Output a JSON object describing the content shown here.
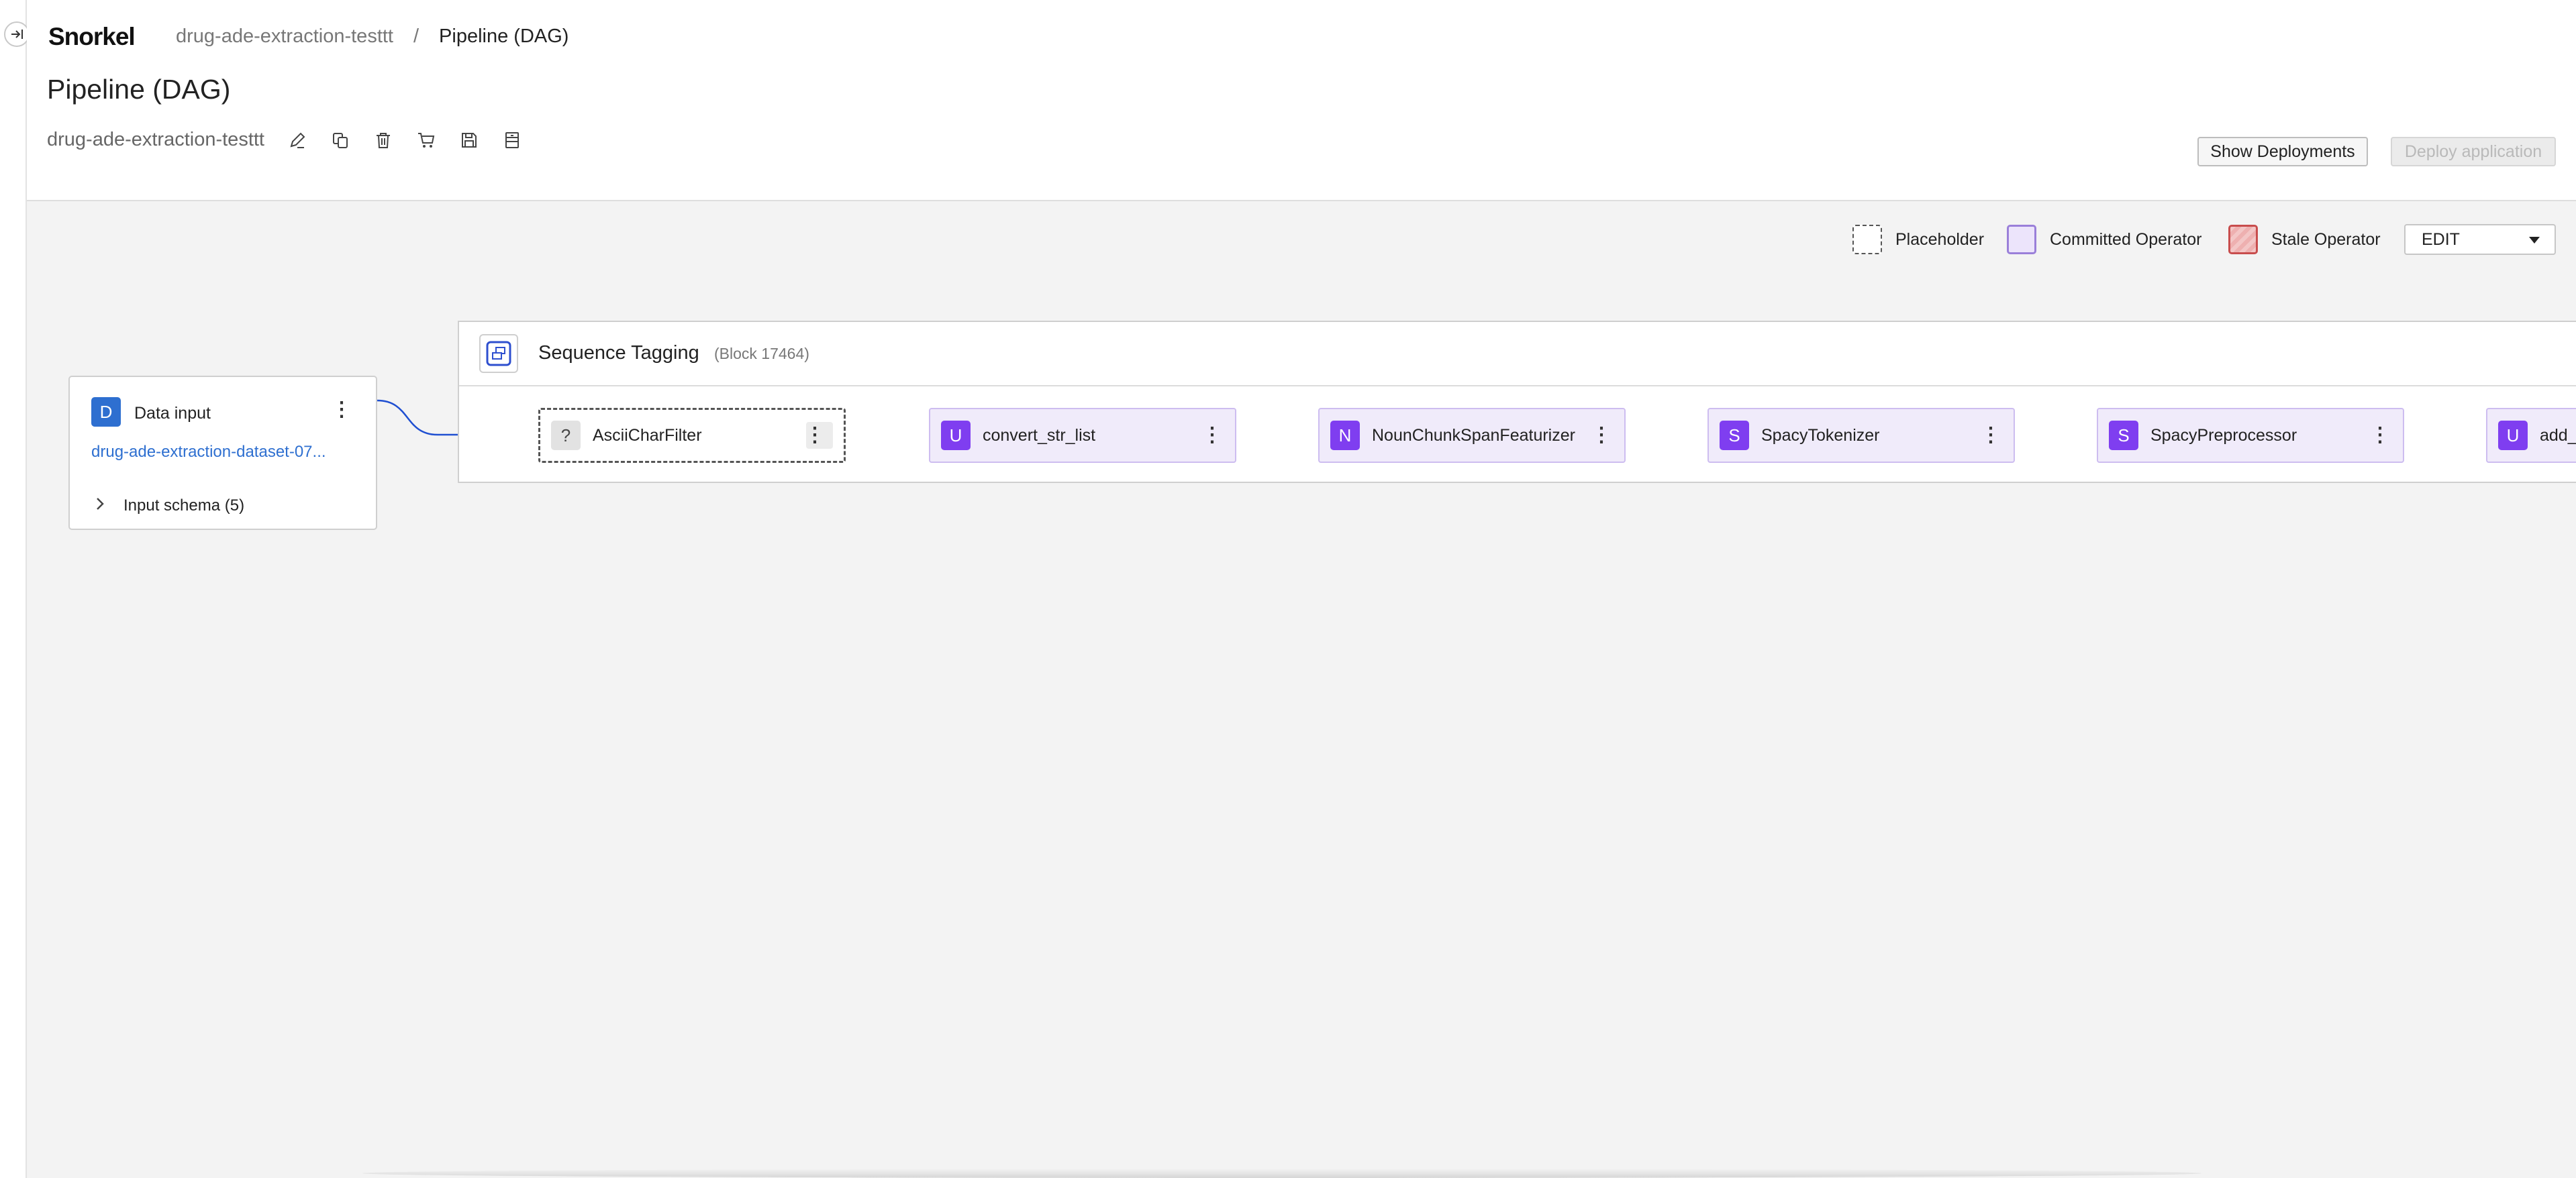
{
  "brand": {
    "logo_text": "Snorkel"
  },
  "breadcrumb": {
    "project": "drug-ade-extraction-testtt",
    "separator": "/",
    "current": "Pipeline (DAG)"
  },
  "page": {
    "title": "Pipeline (DAG)"
  },
  "app": {
    "name": "drug-ade-extraction-testtt",
    "tools": [
      "edit-icon",
      "copy-icon",
      "delete-icon",
      "cart-icon",
      "save-icon",
      "archive-icon"
    ]
  },
  "actions": {
    "show_deployments": "Show Deployments",
    "deploy_application": "Deploy application"
  },
  "legend": {
    "placeholder": "Placeholder",
    "committed": "Committed Operator",
    "stale": "Stale Operator"
  },
  "mode": {
    "selected": "EDIT"
  },
  "data_input": {
    "badge": "D",
    "title": "Data input",
    "dataset": "drug-ade-extraction-dataset-07...",
    "schema_label": "Input schema (5)"
  },
  "block": {
    "title": "Sequence Tagging",
    "subtitle": "(Block 17464)"
  },
  "operators": [
    {
      "badge": "?",
      "name": "AsciiCharFilter",
      "state": "placeholder"
    },
    {
      "badge": "U",
      "name": "convert_str_list",
      "state": "committed"
    },
    {
      "badge": "N",
      "name": "NounChunkSpanFeaturizer",
      "state": "committed"
    },
    {
      "badge": "S",
      "name": "SpacyTokenizer",
      "state": "committed"
    },
    {
      "badge": "S",
      "name": "SpacyPreprocessor",
      "state": "committed"
    },
    {
      "badge": "U",
      "name": "add_",
      "state": "committed"
    }
  ],
  "colors": {
    "accent_blue": "#2e6fd0",
    "operator_purple": "#7f3ef0",
    "committed_fill": "#f0ebfa",
    "stale_red": "#c84d4d",
    "wire": "#1f4fd1"
  }
}
